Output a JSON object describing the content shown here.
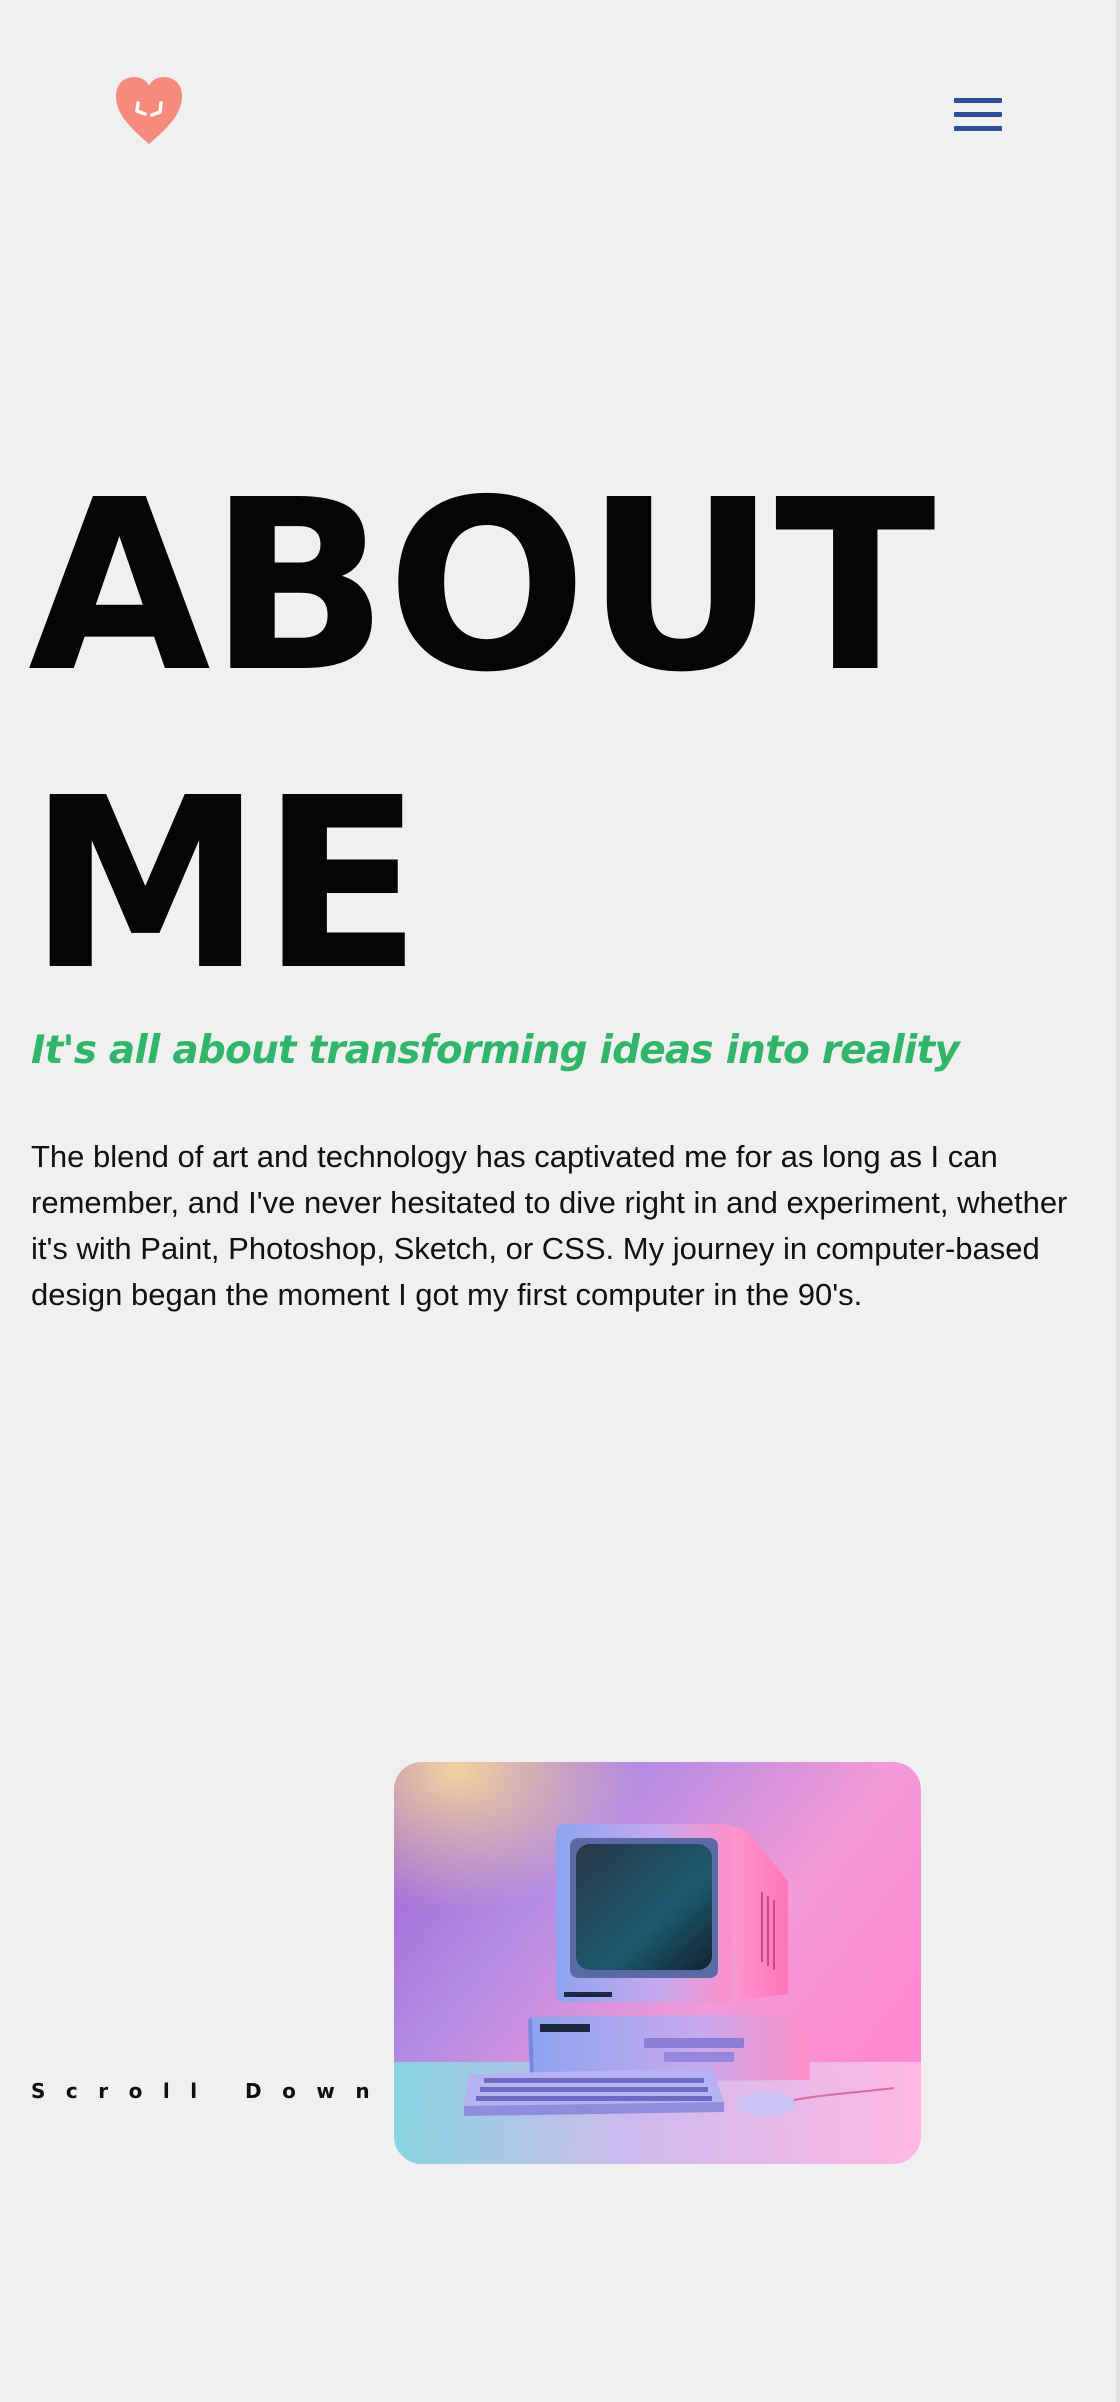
{
  "header": {
    "logo_icon": "heart-smile-icon",
    "menu_icon": "hamburger-menu-icon",
    "colors": {
      "logo": "#f58a7d",
      "menu": "#2e4f9c"
    }
  },
  "hero": {
    "title_line1": "ABOUT",
    "title_line2": "ME",
    "tagline": "It's all about transforming ideas into reality",
    "intro": "The blend of art and technology has captivated me for as long as I can remember, and I've never hesitated to dive right in and experiment, whether it's with Paint, Photoshop, Sketch, or CSS. My journey in computer-based design began the moment I got my first computer in the 90's.",
    "colors": {
      "tagline": "#31b56a",
      "background": "#f0f0f0"
    }
  },
  "scroll": {
    "label": "Scroll Down"
  },
  "image": {
    "subject": "retro-computer-illustration"
  }
}
